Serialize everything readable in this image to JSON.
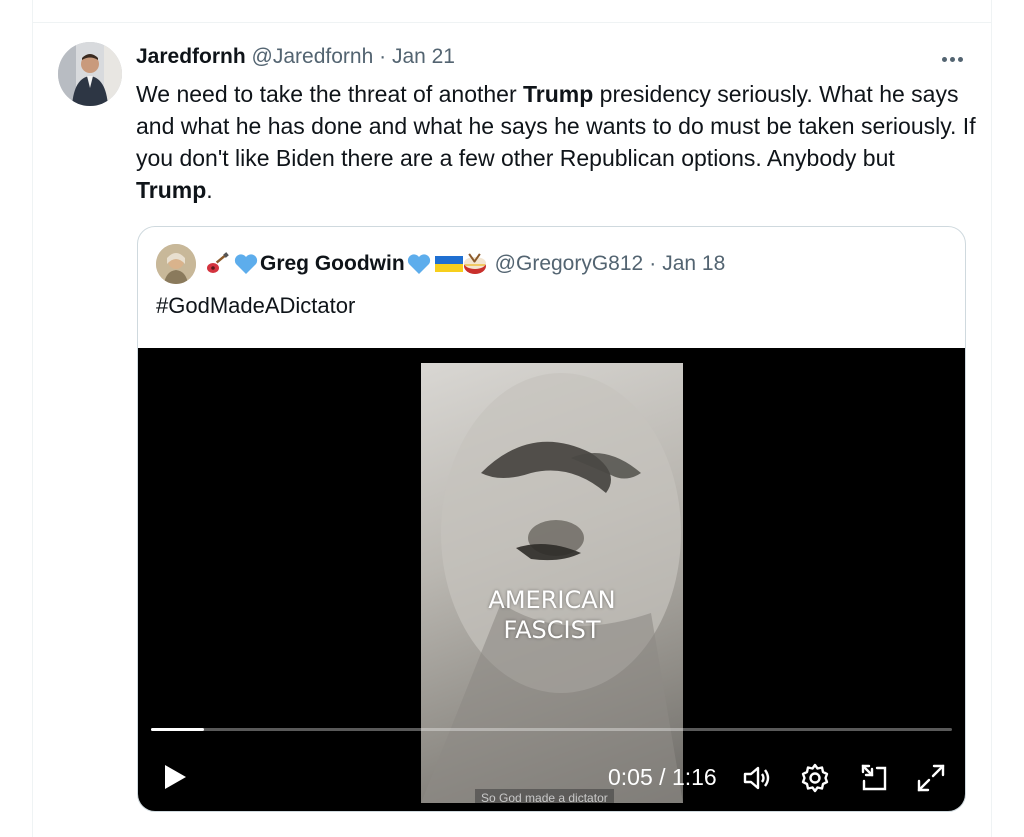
{
  "tweet": {
    "author_name": "Jaredfornh",
    "author_handle": "@Jaredfornh",
    "separator": "·",
    "date": "Jan 21",
    "more_icon": "more-horizontal-icon",
    "text": {
      "part1": "We need to take the threat of another ",
      "bold1": "Trump",
      "part2": " presidency seriously. What he says and what he has done and what he says he wants to do must be taken seriously. If you don't like Biden there are a few other Republican options. Anybody but ",
      "bold2": "Trump",
      "part3": "."
    }
  },
  "quoted_tweet": {
    "author_name": "Greg Goodwin",
    "name_prefix_emojis": [
      "guitar-emoji",
      "blue-heart-emoji"
    ],
    "name_suffix_emojis": [
      "blue-heart-emoji",
      "ukraine-flag-emoji",
      "drum-emoji"
    ],
    "author_handle": "@GregoryG812",
    "separator": "·",
    "date": "Jan 18",
    "text": "#GodMadeADictator"
  },
  "video": {
    "overlay_line1": "AMERICAN",
    "overlay_line2": "FASCIST",
    "caption": "So God made a dictator",
    "current_time": "0:05",
    "time_separator": " / ",
    "duration": "1:16",
    "progress": 0.066,
    "controls": [
      "play-icon",
      "volume-icon",
      "settings-icon",
      "minimize-icon",
      "fullscreen-icon"
    ]
  },
  "colors": {
    "text_primary": "#0f1419",
    "text_secondary": "#536471",
    "border": "#cfd9de",
    "video_bg": "#000000"
  }
}
